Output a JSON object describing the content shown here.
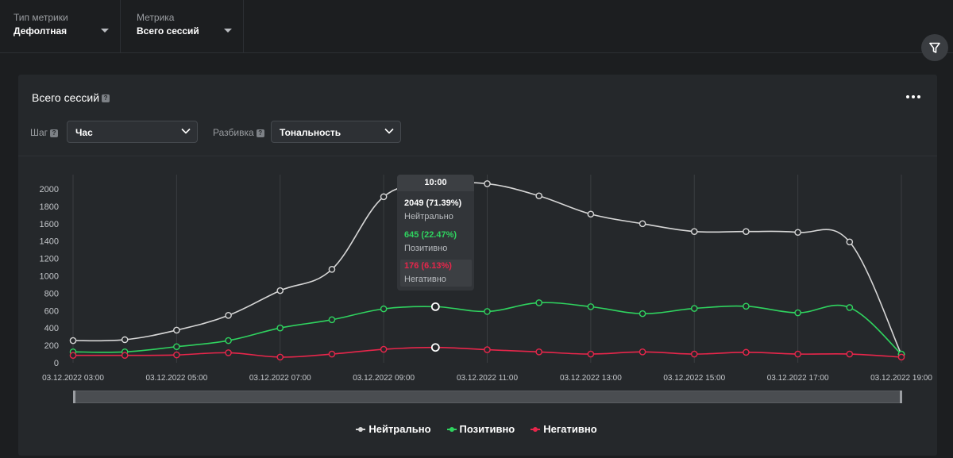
{
  "filters": {
    "metric_type": {
      "label": "Тип метрики",
      "value": "Дефолтная"
    },
    "metric": {
      "label": "Метрика",
      "value": "Всего сессий"
    }
  },
  "icons": {
    "filter": "filter-icon",
    "more": "more-dots-icon",
    "help": "help-icon",
    "chevron": "chevron-down-icon"
  },
  "card": {
    "title": "Всего сессий",
    "step": {
      "label": "Шаг",
      "value": "Час"
    },
    "breakdown": {
      "label": "Разбивка",
      "value": "Тональность"
    }
  },
  "tooltip": {
    "time": "10:00",
    "rows": [
      {
        "value": "2049 (71.39%)",
        "name": "Нейтрально"
      },
      {
        "value": "645 (22.47%)",
        "name": "Позитивно"
      },
      {
        "value": "176 (6.13%)",
        "name": "Негативно"
      }
    ]
  },
  "legend": [
    "Нейтрально",
    "Позитивно",
    "Негативно"
  ],
  "colors": {
    "neutral": "#d6d6d6",
    "positive": "#2fd35f",
    "negative": "#e8264b",
    "background": "#1c1e20",
    "card": "#25282b"
  },
  "chart_data": {
    "type": "line",
    "x": [
      "03:00",
      "04:00",
      "05:00",
      "06:00",
      "07:00",
      "08:00",
      "09:00",
      "10:00",
      "11:00",
      "12:00",
      "13:00",
      "14:00",
      "15:00",
      "16:00",
      "17:00",
      "18:00",
      "19:00"
    ],
    "x_tick_labels": [
      "03.12.2022 03:00",
      "03.12.2022 05:00",
      "03.12.2022 07:00",
      "03.12.2022 09:00",
      "03.12.2022 11:00",
      "03.12.2022 13:00",
      "03.12.2022 15:00",
      "03.12.2022 17:00",
      "03.12.2022 19:00"
    ],
    "y_ticks": [
      0,
      200,
      400,
      600,
      800,
      1000,
      1200,
      1400,
      1600,
      1800,
      2000
    ],
    "ylim": [
      0,
      2000
    ],
    "grid": "vertical",
    "highlight_index": 7,
    "series": [
      {
        "name": "Нейтрально",
        "color": "#d6d6d6",
        "values": [
          255,
          265,
          375,
          545,
          830,
          1075,
          1910,
          2049,
          2060,
          1920,
          1710,
          1600,
          1510,
          1510,
          1500,
          1390,
          95
        ]
      },
      {
        "name": "Позитивно",
        "color": "#2fd35f",
        "values": [
          125,
          125,
          185,
          255,
          400,
          495,
          620,
          645,
          590,
          690,
          645,
          565,
          625,
          650,
          575,
          635,
          100
        ]
      },
      {
        "name": "Негативно",
        "color": "#e8264b",
        "values": [
          85,
          85,
          90,
          115,
          65,
          100,
          155,
          176,
          150,
          125,
          100,
          125,
          100,
          120,
          100,
          100,
          65
        ]
      }
    ]
  }
}
